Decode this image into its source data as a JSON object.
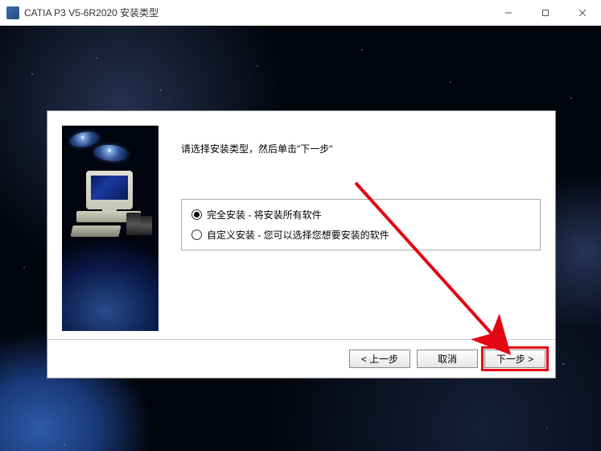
{
  "window": {
    "title": "CATIA P3 V5-6R2020 安装类型"
  },
  "dialog": {
    "instruction": "请选择安装类型，然后单击\"下一步\"",
    "options": {
      "full": "完全安装 - 将安装所有软件",
      "custom": "自定义安装 - 您可以选择您想要安装的软件"
    },
    "selected_option": "full"
  },
  "buttons": {
    "back": "< 上一步",
    "cancel": "取消",
    "next": "下一步 >"
  }
}
